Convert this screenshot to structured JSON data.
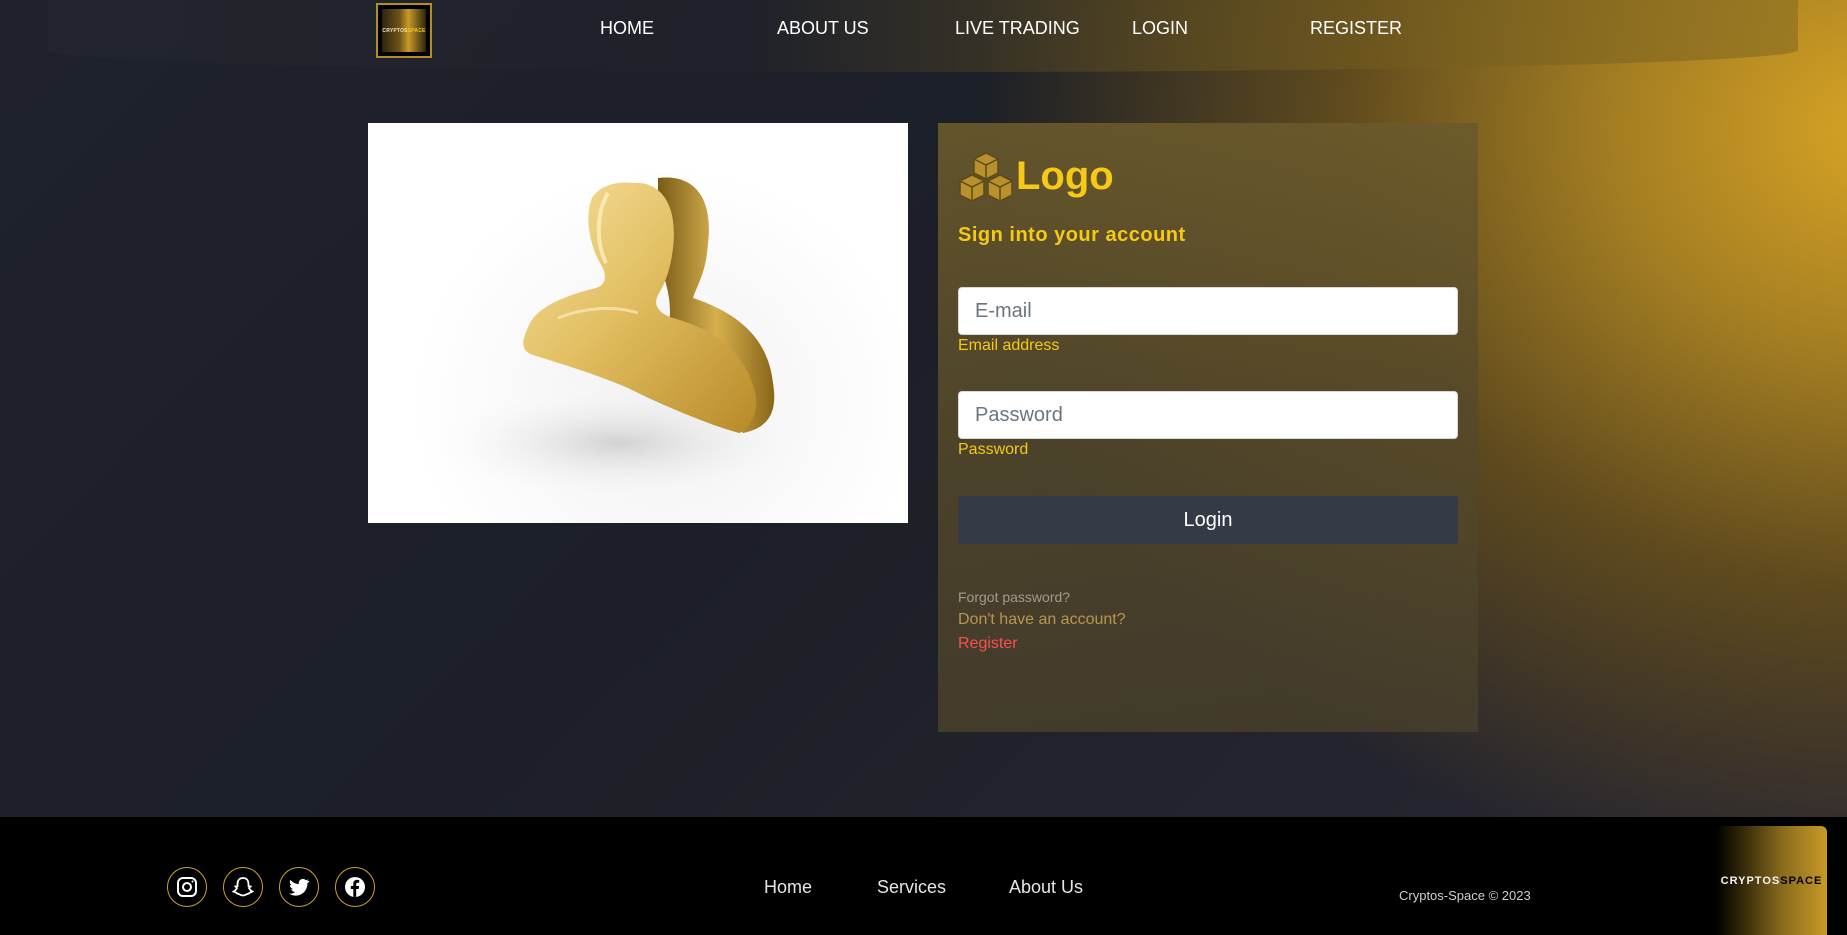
{
  "nav": {
    "brand": {
      "text_left": "CRYPTOS",
      "text_right": "SPACE"
    },
    "links": [
      "HOME",
      "ABOUT US",
      "LIVE TRADING",
      "LOGIN",
      "REGISTER"
    ]
  },
  "login": {
    "logo_text": "Logo",
    "title": "Sign into your account",
    "email": {
      "placeholder": "E-mail",
      "label": "Email address"
    },
    "password": {
      "placeholder": "Password",
      "label": "Password"
    },
    "submit_label": "Login",
    "forgot": "Forgot password?",
    "no_account": "Don't have an account?",
    "register": "Register"
  },
  "footer": {
    "social_icons": [
      "instagram-icon",
      "snapchat-icon",
      "twitter-icon",
      "facebook-icon"
    ],
    "links": [
      "Home",
      "Services",
      "About Us"
    ],
    "copyright": "Cryptos-Space © 2023",
    "badge": {
      "text_left": "CRYPTOS",
      "text_right": "SPACE"
    }
  },
  "colors": {
    "accent_gold": "#f6c916",
    "button_dark": "#343a46",
    "register_red": "#ff4d4d"
  }
}
